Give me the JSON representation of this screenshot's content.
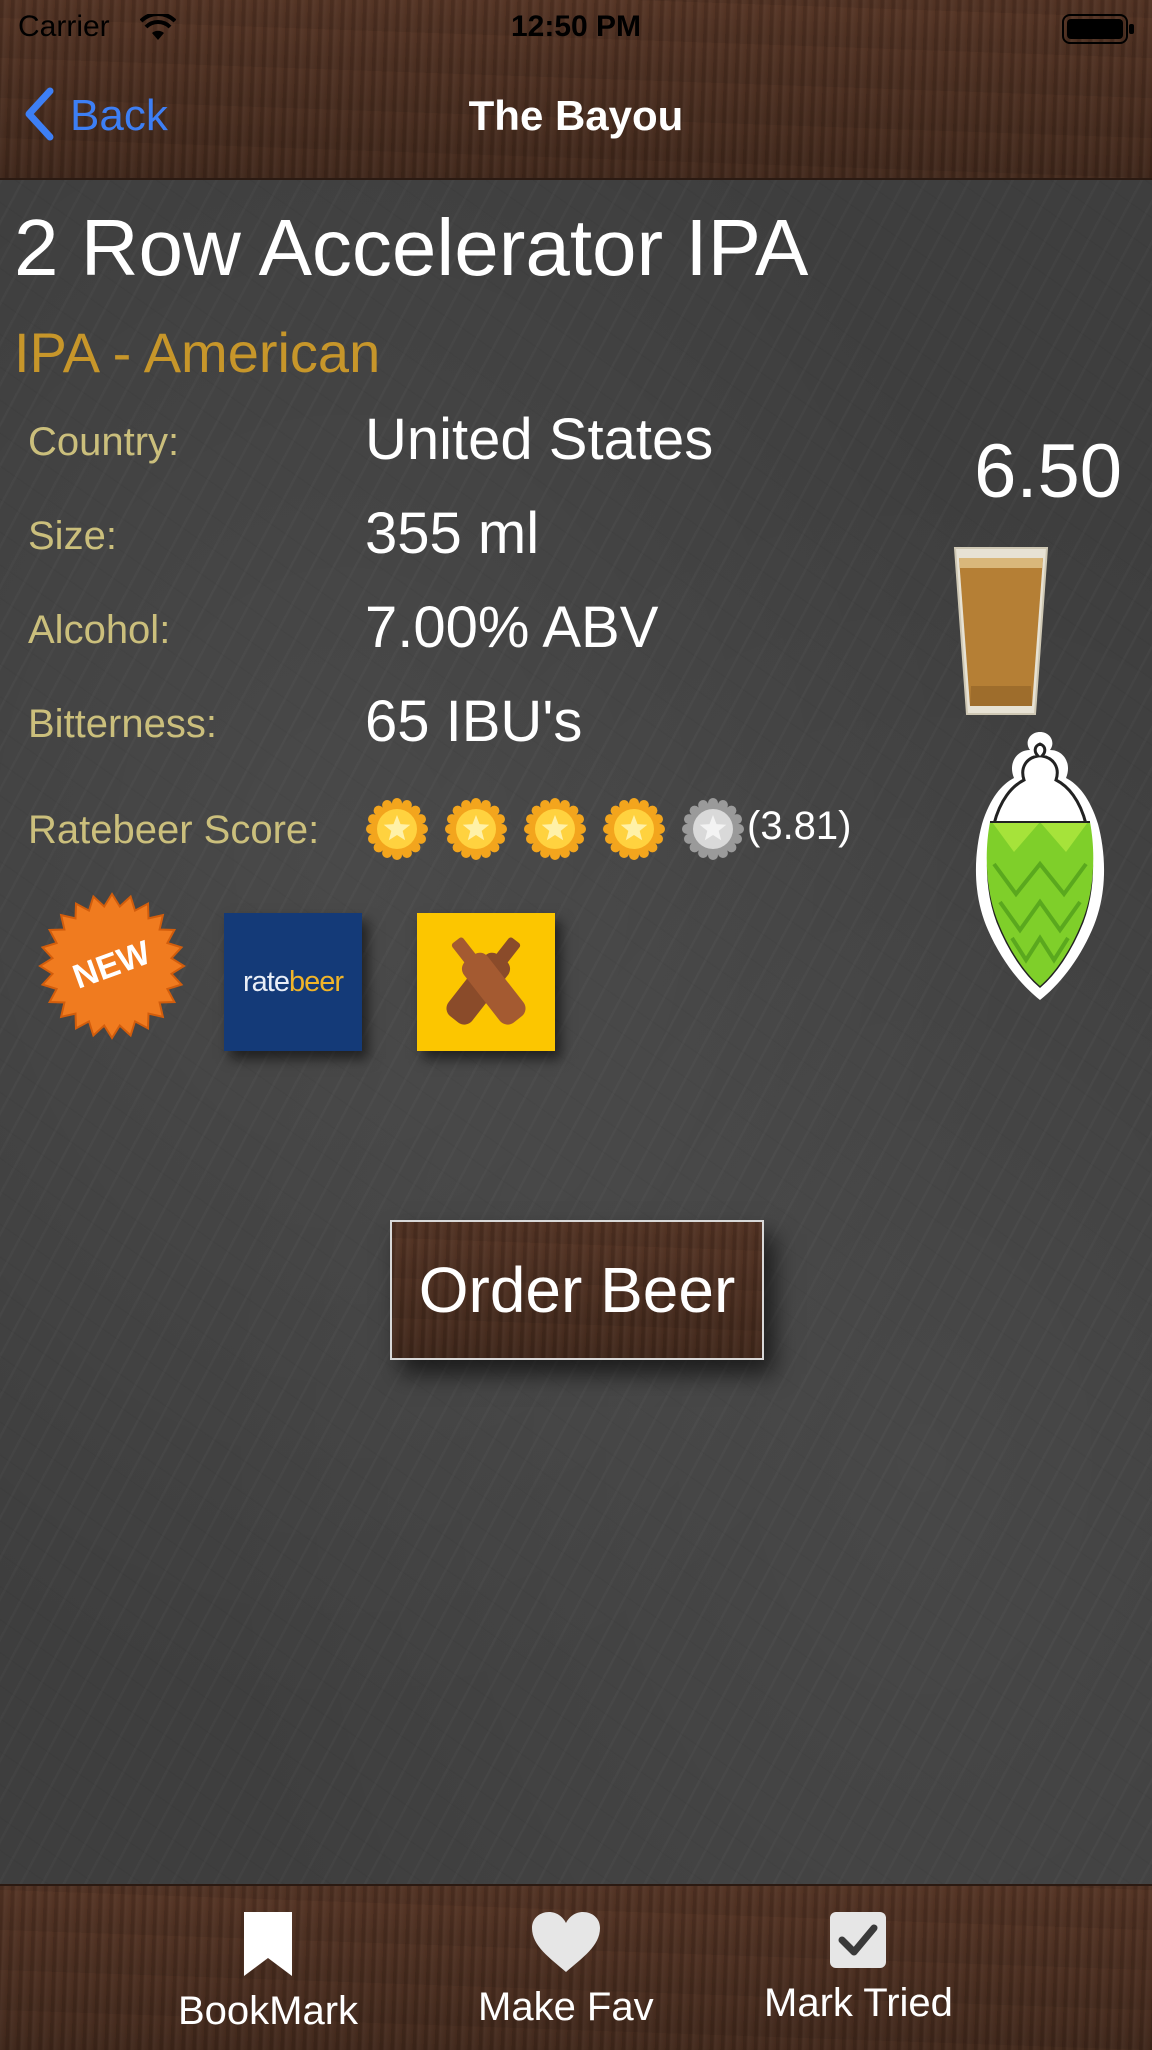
{
  "status_bar": {
    "carrier": "Carrier",
    "time": "12:50 PM"
  },
  "nav": {
    "back_label": "Back",
    "title": "The Bayou"
  },
  "beer": {
    "name": "2 Row Accelerator IPA",
    "style": "IPA - American",
    "price": "6.50",
    "details": [
      {
        "label": "Country:",
        "value": "United States"
      },
      {
        "label": "Size:",
        "value": "355 ml"
      },
      {
        "label": "Alcohol:",
        "value": "7.00% ABV"
      },
      {
        "label": "Bitterness:",
        "value": "65 IBU's"
      }
    ],
    "rating": {
      "label": "Ratebeer Score:",
      "stars_filled": 4,
      "stars_total": 5,
      "score_text": "(3.81)"
    },
    "badges": {
      "new_badge": "NEW",
      "ratebeer_part1": "rate",
      "ratebeer_part2": "beer"
    }
  },
  "actions": {
    "order_label": "Order Beer"
  },
  "tabs": [
    {
      "label": "BookMark",
      "icon": "bookmark-icon"
    },
    {
      "label": "Make Fav",
      "icon": "heart-icon"
    },
    {
      "label": "Mark Tried",
      "icon": "checkbox-icon"
    }
  ],
  "colors": {
    "style_gold": "#c7962a",
    "label_khaki": "#cbbf7c",
    "link_blue": "#3d7ff5",
    "wood_brown": "#4a2d1f"
  }
}
